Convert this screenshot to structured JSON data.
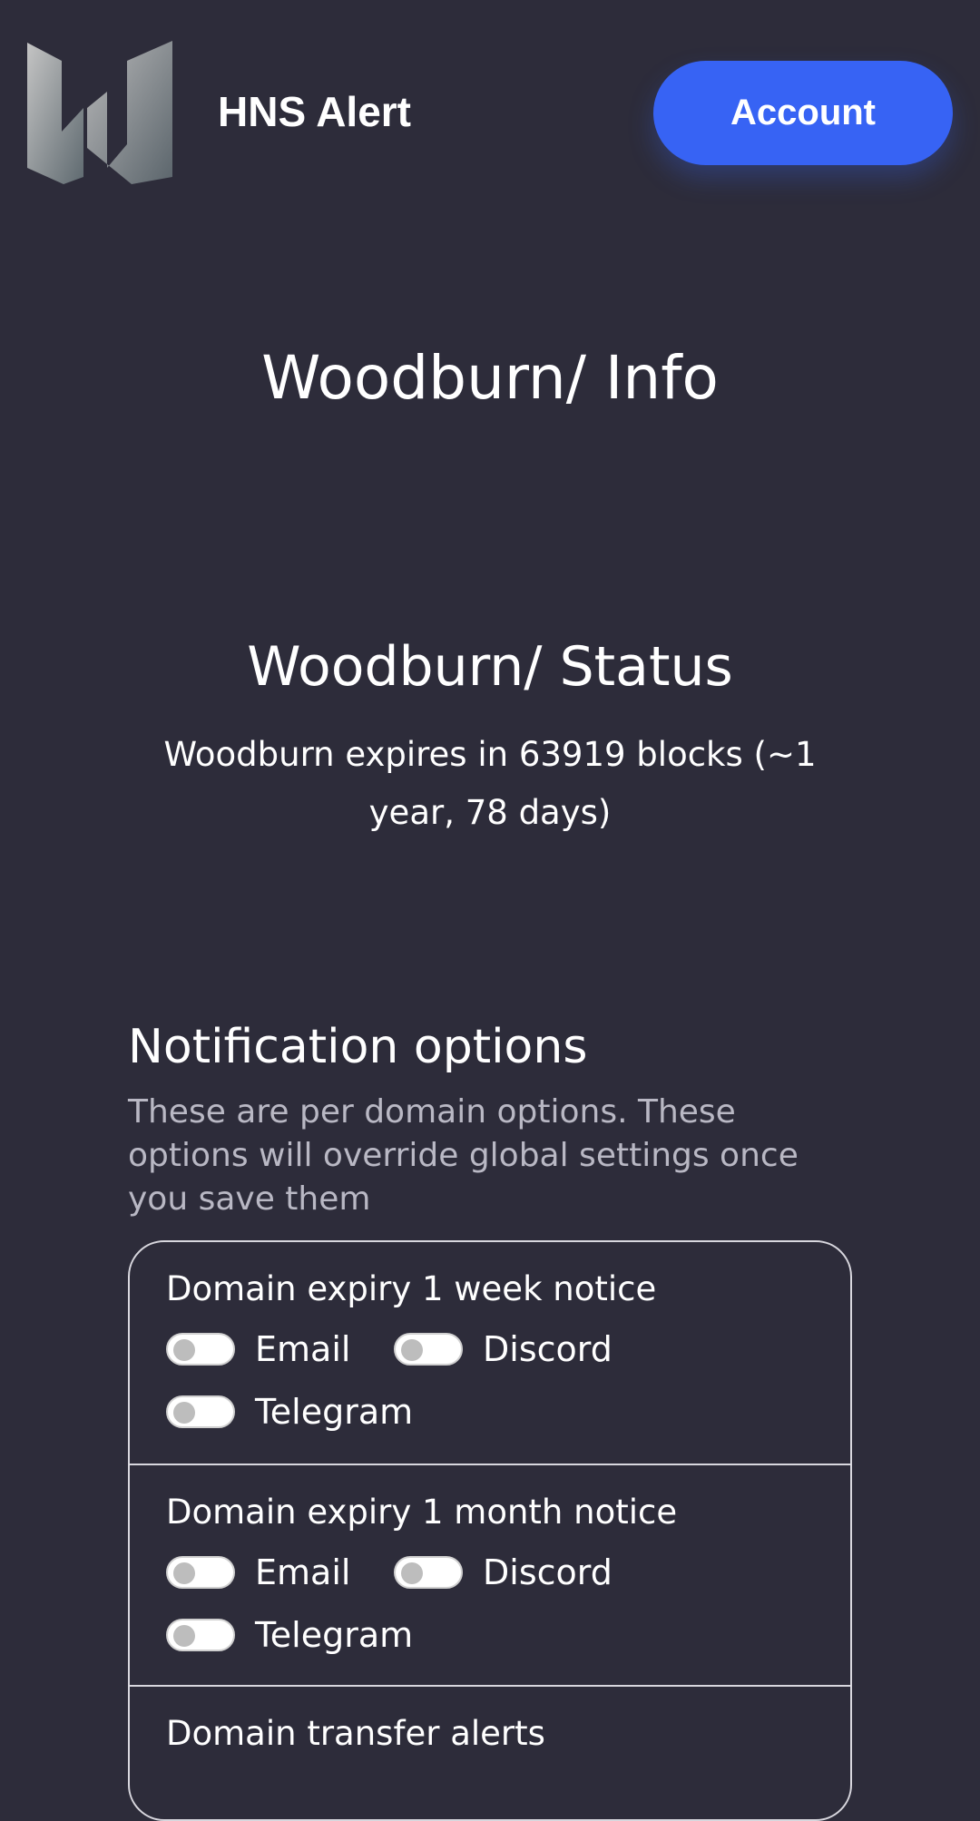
{
  "header": {
    "brand": "HNS Alert",
    "account_label": "Account",
    "logo_icon": "w-logo-icon"
  },
  "main": {
    "info_title": "Woodburn/ Info",
    "status_title": "Woodburn/ Status",
    "status_text": "Woodburn expires in 63919 blocks (~1 year, 78 days)"
  },
  "notifications": {
    "title": "Notification options",
    "description": "These are per domain options. These options will override global settings once you save them",
    "sections": [
      {
        "label": "Domain expiry 1 week notice",
        "email": "Email",
        "discord": "Discord",
        "telegram": "Telegram"
      },
      {
        "label": "Domain expiry 1 month notice",
        "email": "Email",
        "discord": "Discord",
        "telegram": "Telegram"
      },
      {
        "label": "Domain transfer alerts"
      }
    ]
  },
  "colors": {
    "background": "#2d2c3a",
    "accent": "#3763f4",
    "muted_text": "#b9b8c4",
    "border": "#d8d7de"
  }
}
